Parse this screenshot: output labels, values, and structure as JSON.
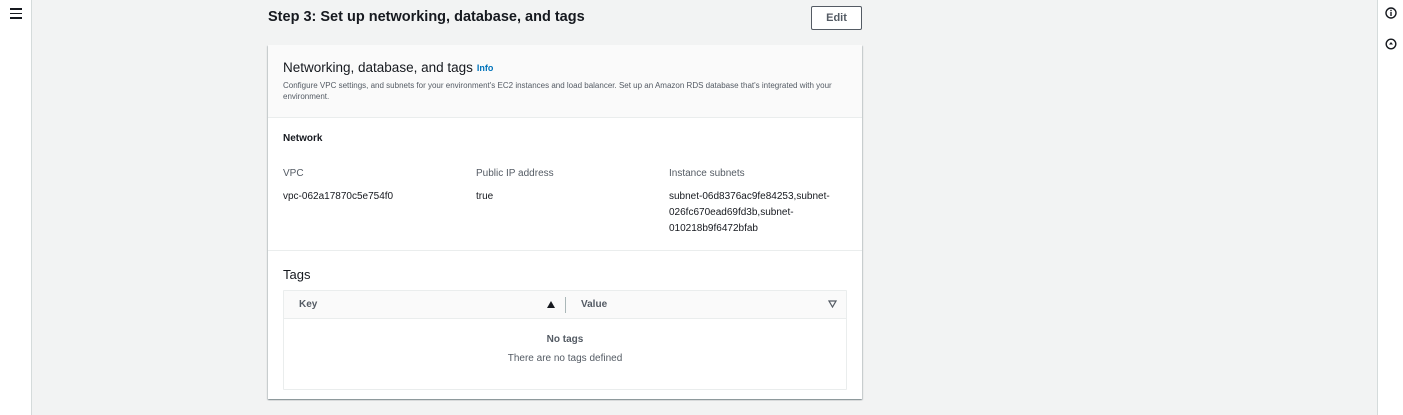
{
  "nav": {
    "menu_icon": "hamburger-icon"
  },
  "right_rail": {
    "icons": [
      "info-icon",
      "notifications-icon"
    ]
  },
  "step": {
    "title": "Step 3: Set up networking, database, and tags",
    "edit_label": "Edit"
  },
  "card": {
    "title": "Networking, database, and tags",
    "info_label": "Info",
    "description": "Configure VPC settings, and subnets for your environment's EC2 instances and load balancer. Set up an Amazon RDS database that's integrated with your environment."
  },
  "network": {
    "section_label": "Network",
    "fields": [
      {
        "key": "VPC",
        "value": "vpc-062a17870c5e754f0"
      },
      {
        "key": "Public IP address",
        "value": "true"
      },
      {
        "key": "Instance subnets",
        "value_lines": [
          "subnet-06d8376ac9fe84253,subnet-",
          "026fc670ead69fd3b,subnet-",
          "010218b9f6472bfab"
        ]
      }
    ]
  },
  "tags": {
    "title": "Tags",
    "columns": [
      {
        "label": "Key",
        "sort": "ascending"
      },
      {
        "label": "Value",
        "sort": "none"
      }
    ],
    "empty_title": "No tags",
    "empty_desc": "There are no tags defined"
  },
  "colors": {
    "accent_link": "#0073bb",
    "text_primary": "#16191f",
    "text_secondary": "#545b64",
    "background": "#f2f3f3"
  }
}
